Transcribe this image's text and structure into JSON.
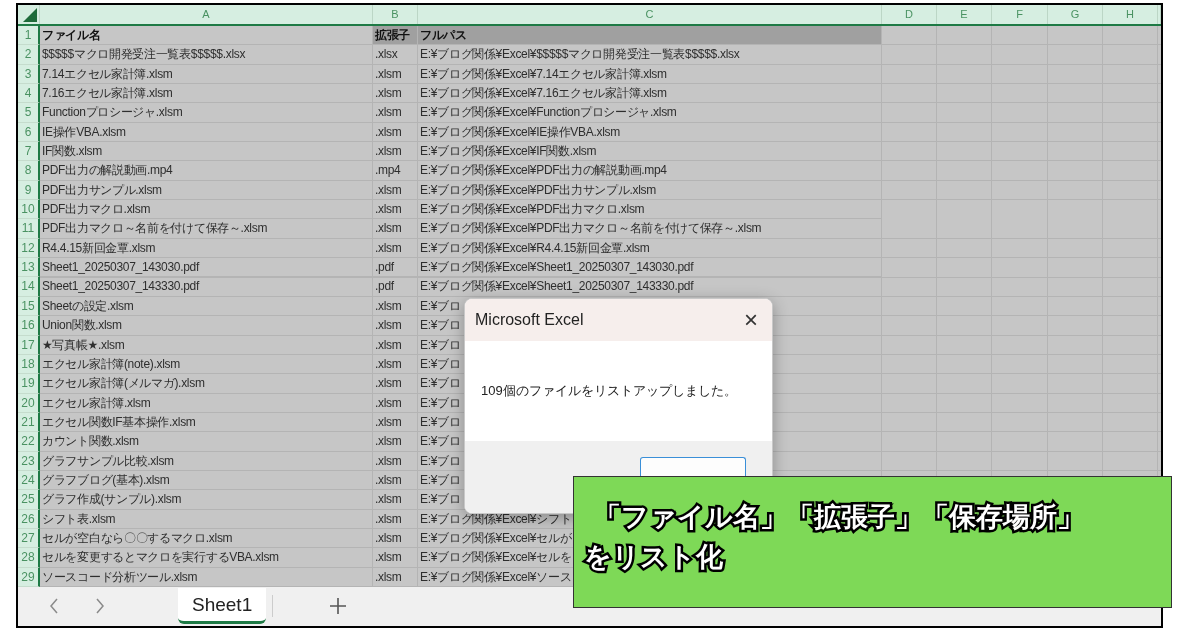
{
  "columns": [
    "A",
    "B",
    "C",
    "D",
    "E",
    "F",
    "G",
    "H"
  ],
  "rows": [
    {
      "number": "1",
      "kind": "header",
      "cells": [
        "ファイル名",
        "拡張子",
        "フルパス"
      ]
    },
    {
      "number": "2",
      "kind": "data",
      "cells": [
        "$$$$$マクロ開発受注一覧表$$$$$.xlsx",
        ".xlsx",
        "E:¥ブログ関係¥Excel¥$$$$$マクロ開発受注一覧表$$$$$.xlsx"
      ]
    },
    {
      "number": "3",
      "kind": "data",
      "cells": [
        "7.14エクセル家計簿.xlsm",
        ".xlsm",
        "E:¥ブログ関係¥Excel¥7.14エクセル家計簿.xlsm"
      ]
    },
    {
      "number": "4",
      "kind": "data",
      "cells": [
        "7.16エクセル家計簿.xlsm",
        ".xlsm",
        "E:¥ブログ関係¥Excel¥7.16エクセル家計簿.xlsm"
      ]
    },
    {
      "number": "5",
      "kind": "data",
      "cells": [
        "Functionプロシージャ.xlsm",
        ".xlsm",
        "E:¥ブログ関係¥Excel¥Functionプロシージャ.xlsm"
      ]
    },
    {
      "number": "6",
      "kind": "data",
      "cells": [
        "IE操作VBA.xlsm",
        ".xlsm",
        "E:¥ブログ関係¥Excel¥IE操作VBA.xlsm"
      ]
    },
    {
      "number": "7",
      "kind": "data",
      "cells": [
        "IF関数.xlsm",
        ".xlsm",
        "E:¥ブログ関係¥Excel¥IF関数.xlsm"
      ]
    },
    {
      "number": "8",
      "kind": "data",
      "cells": [
        "PDF出力の解説動画.mp4",
        ".mp4",
        "E:¥ブログ関係¥Excel¥PDF出力の解説動画.mp4"
      ]
    },
    {
      "number": "9",
      "kind": "data",
      "cells": [
        "PDF出力サンプル.xlsm",
        ".xlsm",
        "E:¥ブログ関係¥Excel¥PDF出力サンプル.xlsm"
      ]
    },
    {
      "number": "10",
      "kind": "data",
      "cells": [
        "PDF出力マクロ.xlsm",
        ".xlsm",
        "E:¥ブログ関係¥Excel¥PDF出力マクロ.xlsm"
      ]
    },
    {
      "number": "11",
      "kind": "data",
      "cells": [
        "PDF出力マクロ～名前を付けて保存～.xlsm",
        ".xlsm",
        "E:¥ブログ関係¥Excel¥PDF出力マクロ～名前を付けて保存～.xlsm"
      ]
    },
    {
      "number": "12",
      "kind": "data",
      "cells": [
        "R4.4.15新回金覃.xlsm",
        ".xlsm",
        "E:¥ブログ関係¥Excel¥R4.4.15新回金覃.xlsm"
      ]
    },
    {
      "number": "13",
      "kind": "data",
      "cells": [
        "Sheet1_20250307_143030.pdf",
        ".pdf",
        "E:¥ブログ関係¥Excel¥Sheet1_20250307_143030.pdf"
      ]
    },
    {
      "number": "14",
      "kind": "data",
      "cells": [
        "Sheet1_20250307_143330.pdf",
        ".pdf",
        "E:¥ブログ関係¥Excel¥Sheet1_20250307_143330.pdf"
      ]
    },
    {
      "number": "15",
      "kind": "data",
      "cells": [
        "Sheetの設定.xlsm",
        ".xlsm",
        "E:¥ブロ"
      ]
    },
    {
      "number": "16",
      "kind": "data",
      "cells": [
        "Union関数.xlsm",
        ".xlsm",
        "E:¥ブロ"
      ]
    },
    {
      "number": "17",
      "kind": "data",
      "cells": [
        "★写真帳★.xlsm",
        ".xlsm",
        "E:¥ブロ"
      ]
    },
    {
      "number": "18",
      "kind": "data",
      "cells": [
        "エクセル家計簿(note).xlsm",
        ".xlsm",
        "E:¥ブロ"
      ]
    },
    {
      "number": "19",
      "kind": "data",
      "cells": [
        "エクセル家計簿(メルマガ).xlsm",
        ".xlsm",
        "E:¥ブロ"
      ]
    },
    {
      "number": "20",
      "kind": "data",
      "cells": [
        "エクセル家計簿.xlsm",
        ".xlsm",
        "E:¥ブロ"
      ]
    },
    {
      "number": "21",
      "kind": "data",
      "cells": [
        "エクセル関数IF基本操作.xlsm",
        ".xlsm",
        "E:¥ブロ"
      ]
    },
    {
      "number": "22",
      "kind": "data",
      "cells": [
        "カウント関数.xlsm",
        ".xlsm",
        "E:¥ブロ"
      ]
    },
    {
      "number": "23",
      "kind": "data",
      "cells": [
        "グラフサンプル比較.xlsm",
        ".xlsm",
        "E:¥ブロ"
      ]
    },
    {
      "number": "24",
      "kind": "data",
      "cells": [
        "グラフブログ(基本).xlsm",
        ".xlsm",
        "E:¥ブロ"
      ]
    },
    {
      "number": "25",
      "kind": "data",
      "cells": [
        "グラフ作成(サンプル).xlsm",
        ".xlsm",
        "E:¥ブロ"
      ]
    },
    {
      "number": "26",
      "kind": "data",
      "cells": [
        "シフト表.xlsm",
        ".xlsm",
        "E:¥ブログ関係¥Excel¥シフト"
      ]
    },
    {
      "number": "27",
      "kind": "data",
      "cells": [
        "セルが空白なら〇〇するマクロ.xlsm",
        ".xlsm",
        "E:¥ブログ関係¥Excel¥セルが"
      ]
    },
    {
      "number": "28",
      "kind": "data",
      "cells": [
        "セルを変更するとマクロを実行するVBA.xlsm",
        ".xlsm",
        "E:¥ブログ関係¥Excel¥セルを"
      ]
    },
    {
      "number": "29",
      "kind": "data",
      "cells": [
        "ソースコード分析ツール.xlsm",
        ".xlsm",
        "E:¥ブログ関係¥Excel¥ソース"
      ]
    }
  ],
  "sheet_tabs": [
    {
      "label": "Sheet1",
      "selected": true
    }
  ],
  "dialog": {
    "title": "Microsoft Excel",
    "close": "×",
    "message": "109個のファイルをリストアップしました。"
  },
  "caption": {
    "lines": [
      "「ファイル名」「拡張子」「保存場所」",
      "をリスト化"
    ]
  }
}
